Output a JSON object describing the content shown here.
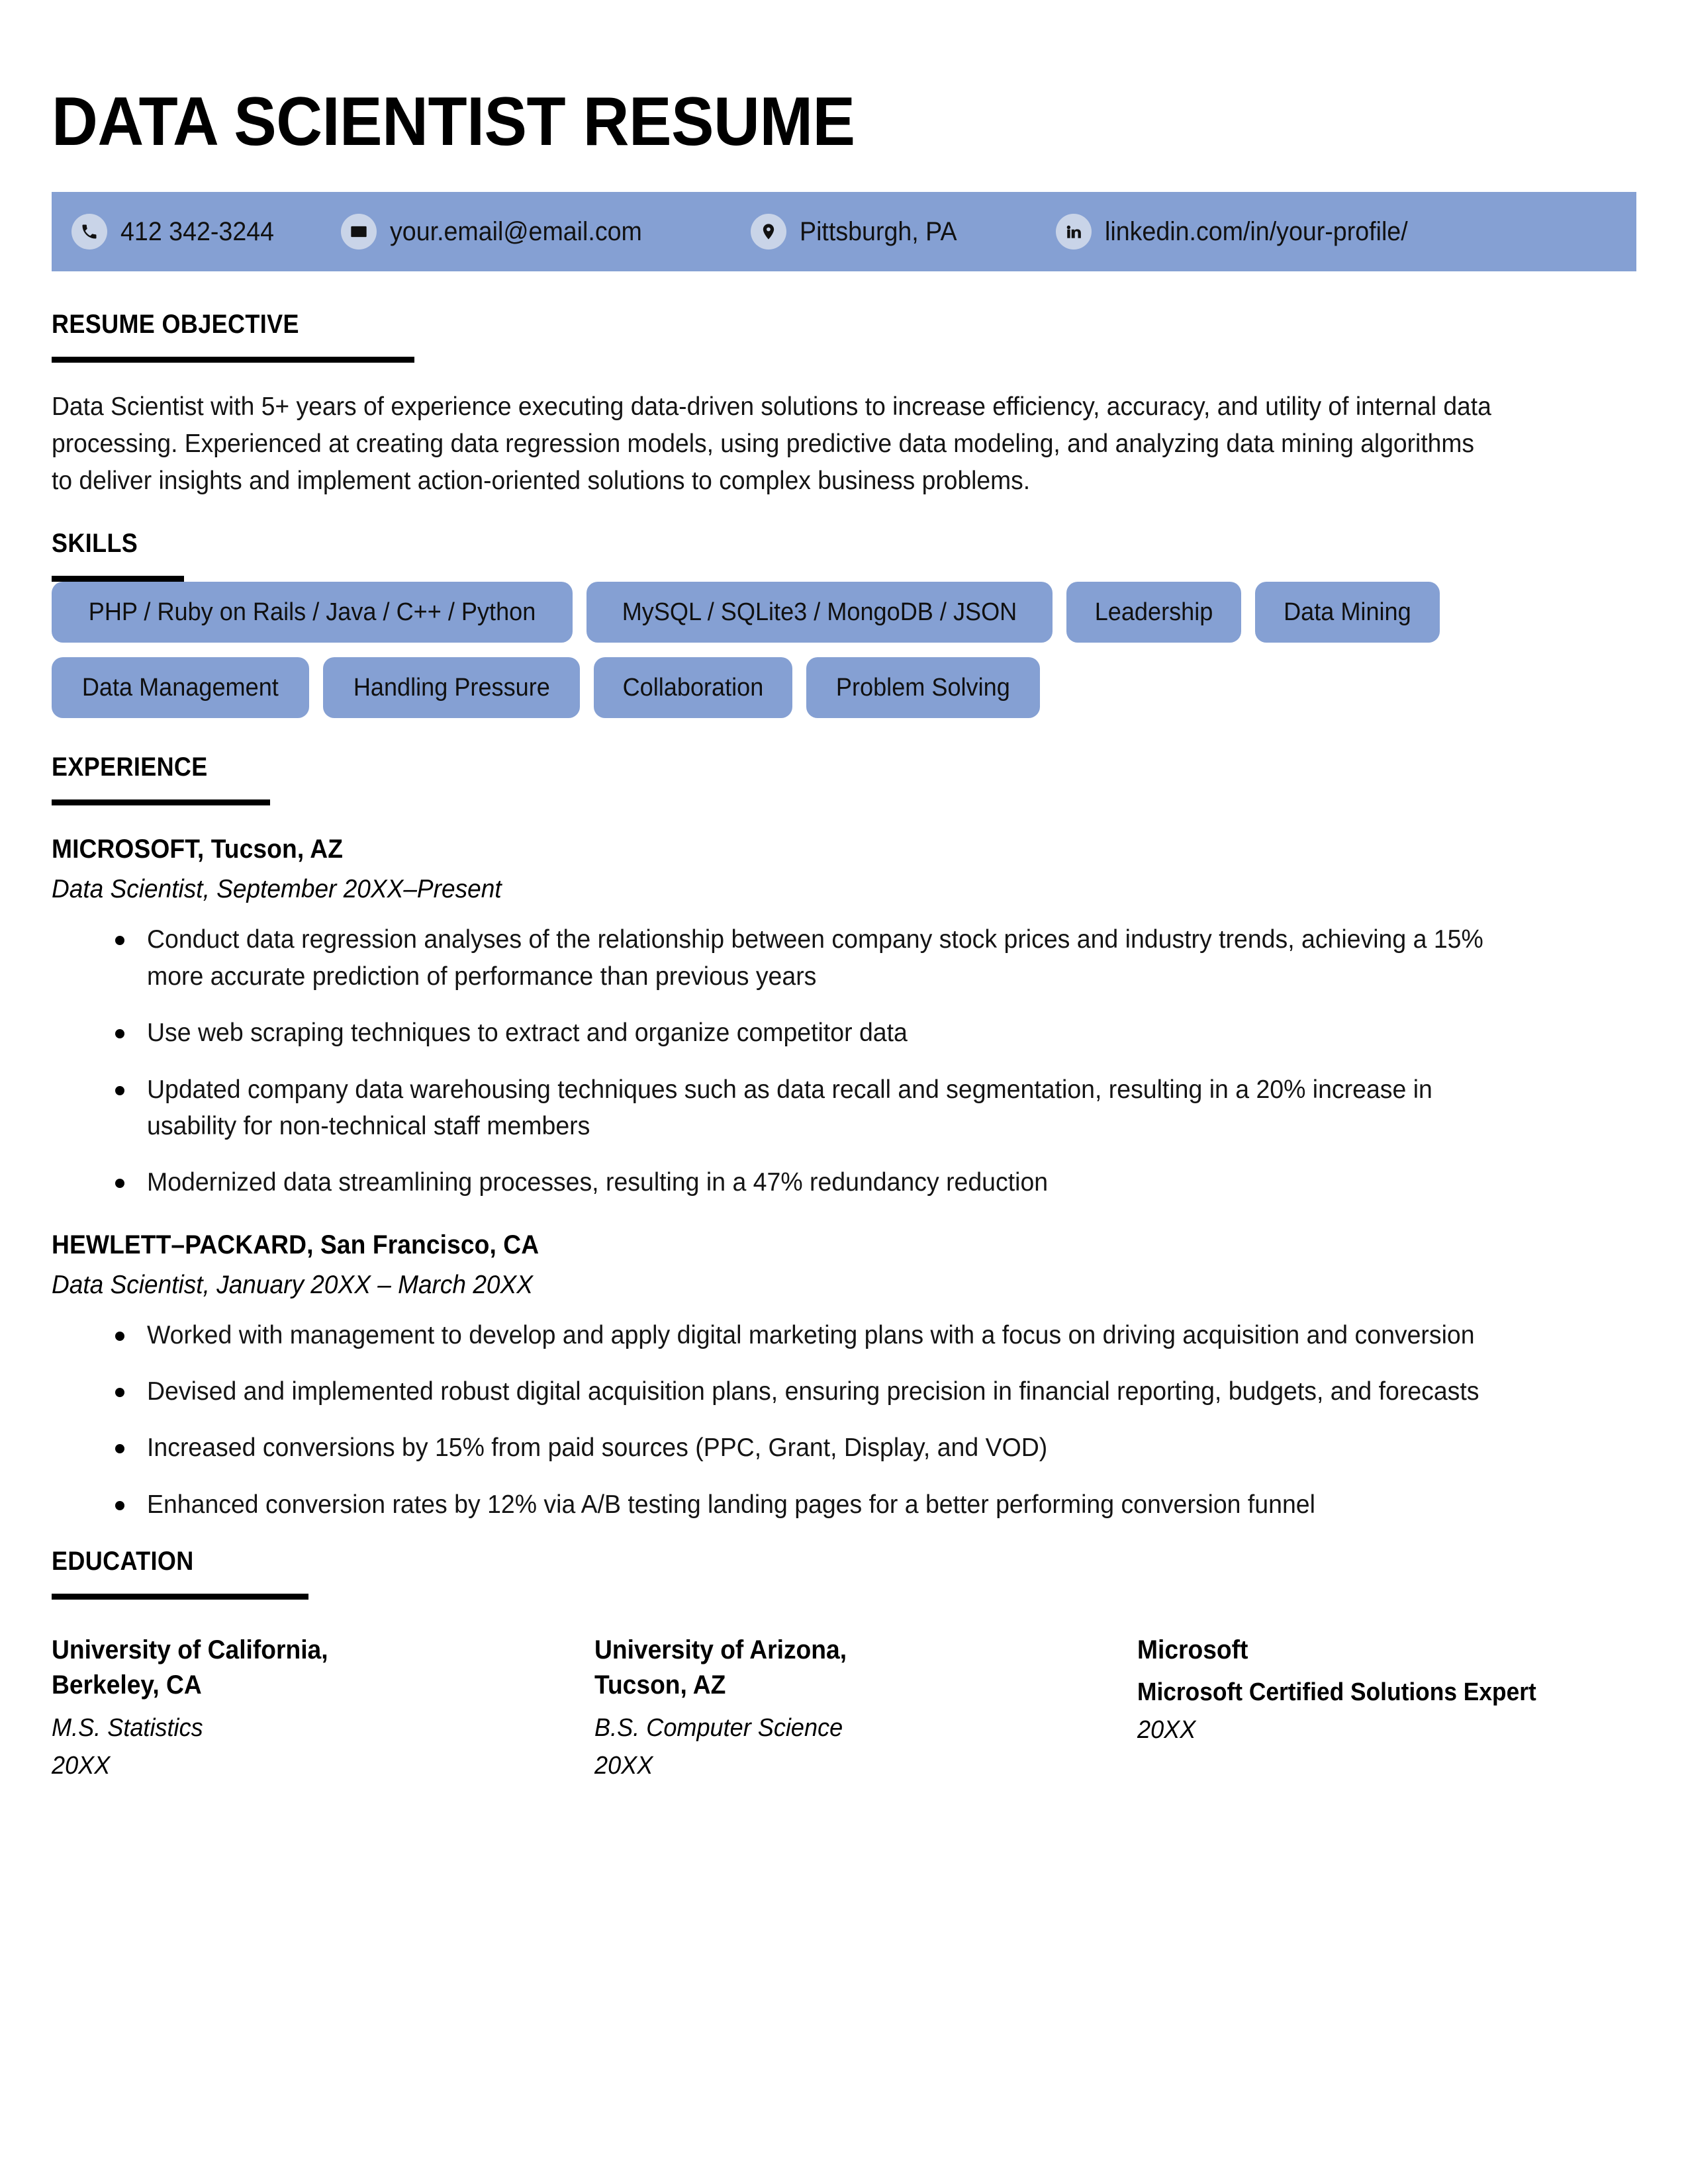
{
  "document": {
    "title": "DATA SCIENTIST RESUME"
  },
  "theme": {
    "accent_blue": "#85A0D3",
    "icon_circle": "#C9D4E8",
    "text_black": "#000000",
    "page_background": "#FFFFFF"
  },
  "contact": {
    "items": [
      {
        "icon": "phone-icon",
        "text": "412 342-3244"
      },
      {
        "icon": "envelope-icon",
        "text": "your.email@email.com"
      },
      {
        "icon": "map-pin-icon",
        "text": "Pittsburgh, PA"
      },
      {
        "icon": "linkedin-icon",
        "text": "linkedin.com/in/your-profile/"
      }
    ]
  },
  "sections": {
    "objective": {
      "heading": "RESUME OBJECTIVE",
      "body": "Data Scientist with 5+ years of experience executing data-driven solutions to increase efficiency, accuracy, and utility of internal data processing. Experienced at creating data regression models, using predictive data modeling, and analyzing data mining algorithms to deliver insights and implement action-oriented solutions to complex business problems."
    },
    "skills": {
      "heading": "SKILLS",
      "items": [
        "PHP / Ruby on Rails / Java / C++ / Python",
        "MySQL / SQLite3 / MongoDB / JSON",
        "Leadership",
        "Data Mining",
        "Data Management",
        "Handling Pressure",
        "Collaboration",
        "Problem Solving"
      ]
    },
    "experience": {
      "heading": "EXPERIENCE",
      "jobs": [
        {
          "company": "MICROSOFT, Tucson, AZ",
          "meta": "Data Scientist, September 20XX–Present",
          "bullets": [
            "Conduct data regression analyses of the relationship between company stock prices and industry trends, achieving a 15% more accurate prediction of performance than previous years",
            "Use web scraping techniques to extract and organize competitor data",
            "Updated company data warehousing techniques such as data recall and segmentation, resulting in a 20% increase in usability for non-technical staff members",
            "Modernized data streamlining processes, resulting in a 47% redundancy reduction"
          ]
        },
        {
          "company": "HEWLETT–PACKARD, San Francisco, CA",
          "meta": "Data Scientist, January 20XX – March 20XX",
          "bullets": [
            "Worked with management to develop and apply digital marketing plans with a focus on driving acquisition and conversion",
            "Devised and implemented robust digital acquisition plans, ensuring precision in financial reporting, budgets, and forecasts",
            "Increased conversions by 15% from paid sources (PPC, Grant, Display, and VOD)",
            "Enhanced conversion rates by 12% via A/B testing landing pages for a better performing conversion funnel"
          ]
        }
      ]
    },
    "education": {
      "heading": "EDUCATION",
      "entries": [
        {
          "school": "University of California, Berkeley, CA",
          "degree": "M.S. Statistics",
          "degree_style": "italic",
          "year": "20XX"
        },
        {
          "school": "University of Arizona, Tucson, AZ",
          "degree": "B.S. Computer Science",
          "degree_style": "italic",
          "year": "20XX"
        },
        {
          "school": "Microsoft",
          "degree": "Microsoft Certified Solutions Expert",
          "degree_style": "bold",
          "year": "20XX"
        }
      ]
    }
  }
}
